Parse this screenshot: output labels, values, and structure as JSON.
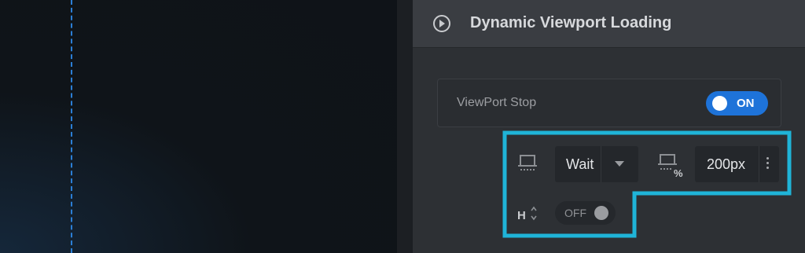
{
  "panel": {
    "title": "Dynamic Viewport Loading",
    "viewport_stop": {
      "label": "ViewPort Stop",
      "toggle": "ON"
    },
    "wait_select": {
      "value": "Wait"
    },
    "offset_input": {
      "value": "200px"
    },
    "height_toggle": {
      "value": "OFF"
    }
  },
  "colors": {
    "accent": "#1e73d9",
    "highlight": "#1fb4d8"
  },
  "icons": [
    "play-circle-icon",
    "viewport-wait-icon",
    "viewport-percent-icon",
    "height-arrows-icon",
    "more-vertical-icon",
    "caret-down-icon"
  ]
}
